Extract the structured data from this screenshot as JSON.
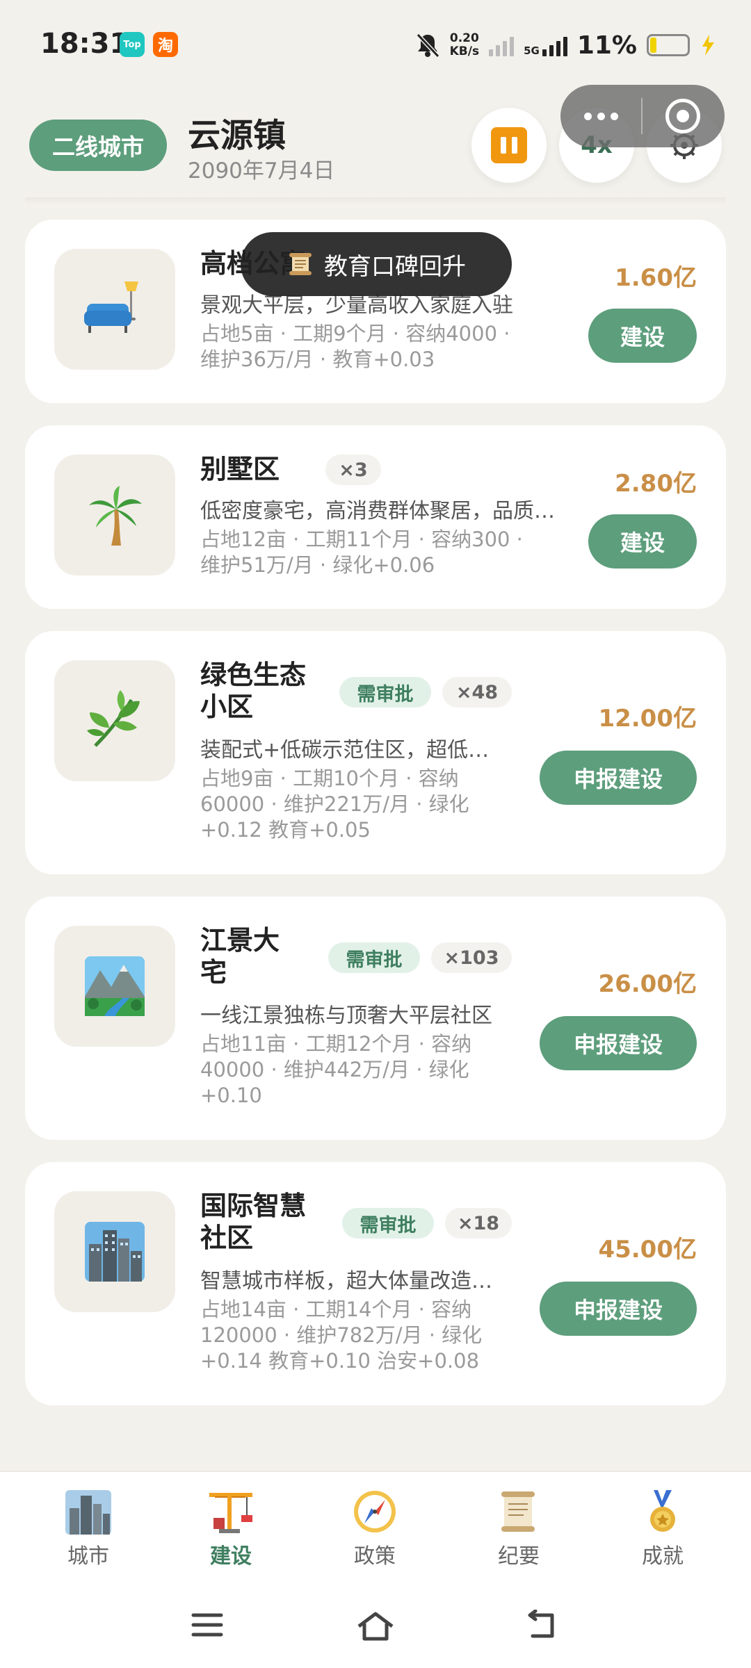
{
  "status_bar": {
    "time": "18:31",
    "apps": [
      "Top",
      "淘"
    ],
    "net_speed_value": "0.20",
    "net_speed_unit": "KB/s",
    "network": "5G",
    "battery": "11%"
  },
  "header": {
    "city_tier": "二线城市",
    "town_name": "云源镇",
    "date": "2090年7月4日",
    "speed": "4x"
  },
  "toast": {
    "icon": "scroll-icon",
    "text": "教育口碑回升"
  },
  "buildings": [
    {
      "icon": "sofa-lamp-icon",
      "name": "高档公寓",
      "desc": "景观大平层，少量高收入家庭入驻",
      "stats": [
        "占地5亩 · 工期9个月 · 容纳4000 ·",
        "维护36万/月 · 教育+0.03"
      ],
      "price": "1.60亿",
      "action": "建设"
    },
    {
      "icon": "palm-tree-icon",
      "name": "别墅区",
      "count": "×3",
      "desc": "低密度豪宅，高消费群体聚居，品质生活",
      "stats": [
        "占地12亩 · 工期11个月 · 容纳300 ·",
        "维护51万/月 · 绿化+0.06"
      ],
      "price": "2.80亿",
      "action": "建设"
    },
    {
      "icon": "leaf-icon",
      "name_lines": [
        "绿色生态",
        "小区"
      ],
      "approval": "需审批",
      "count": "×48",
      "desc": "装配式+低碳示范住区，超低能耗",
      "stats": [
        "占地9亩 · 工期10个月 · 容纳",
        "60000 · 维护221万/月 · 绿化",
        "+0.12 教育+0.05"
      ],
      "price": "12.00亿",
      "action": "申报建设"
    },
    {
      "icon": "river-landscape-icon",
      "name_lines": [
        "江景大",
        "宅"
      ],
      "approval": "需审批",
      "count": "×103",
      "desc": "一线江景独栋与顶奢大平层社区",
      "stats": [
        "占地11亩 · 工期12个月 · 容纳",
        "40000 · 维护442万/月 · 绿化",
        "+0.10"
      ],
      "price": "26.00亿",
      "action": "申报建设"
    },
    {
      "icon": "city-skyline-icon",
      "name_lines": [
        "国际智慧",
        "社区"
      ],
      "approval": "需审批",
      "count": "×18",
      "desc": "智慧城市样板，超大体量改造示范",
      "stats": [
        "占地14亩 · 工期14个月 · 容纳",
        "120000 · 维护782万/月 · 绿化",
        "+0.14 教育+0.10 治安+0.08"
      ],
      "price": "45.00亿",
      "action": "申报建设"
    }
  ],
  "tabs": [
    {
      "label": "城市",
      "icon": "city-icon"
    },
    {
      "label": "建设",
      "icon": "crane-icon",
      "active": true
    },
    {
      "label": "政策",
      "icon": "compass-icon"
    },
    {
      "label": "纪要",
      "icon": "scroll-icon"
    },
    {
      "label": "成就",
      "icon": "medal-icon"
    }
  ],
  "colors": {
    "primary": "#5d9e7c",
    "price": "#c98f47",
    "background": "#f3f1ec",
    "pause": "#f0970f"
  }
}
